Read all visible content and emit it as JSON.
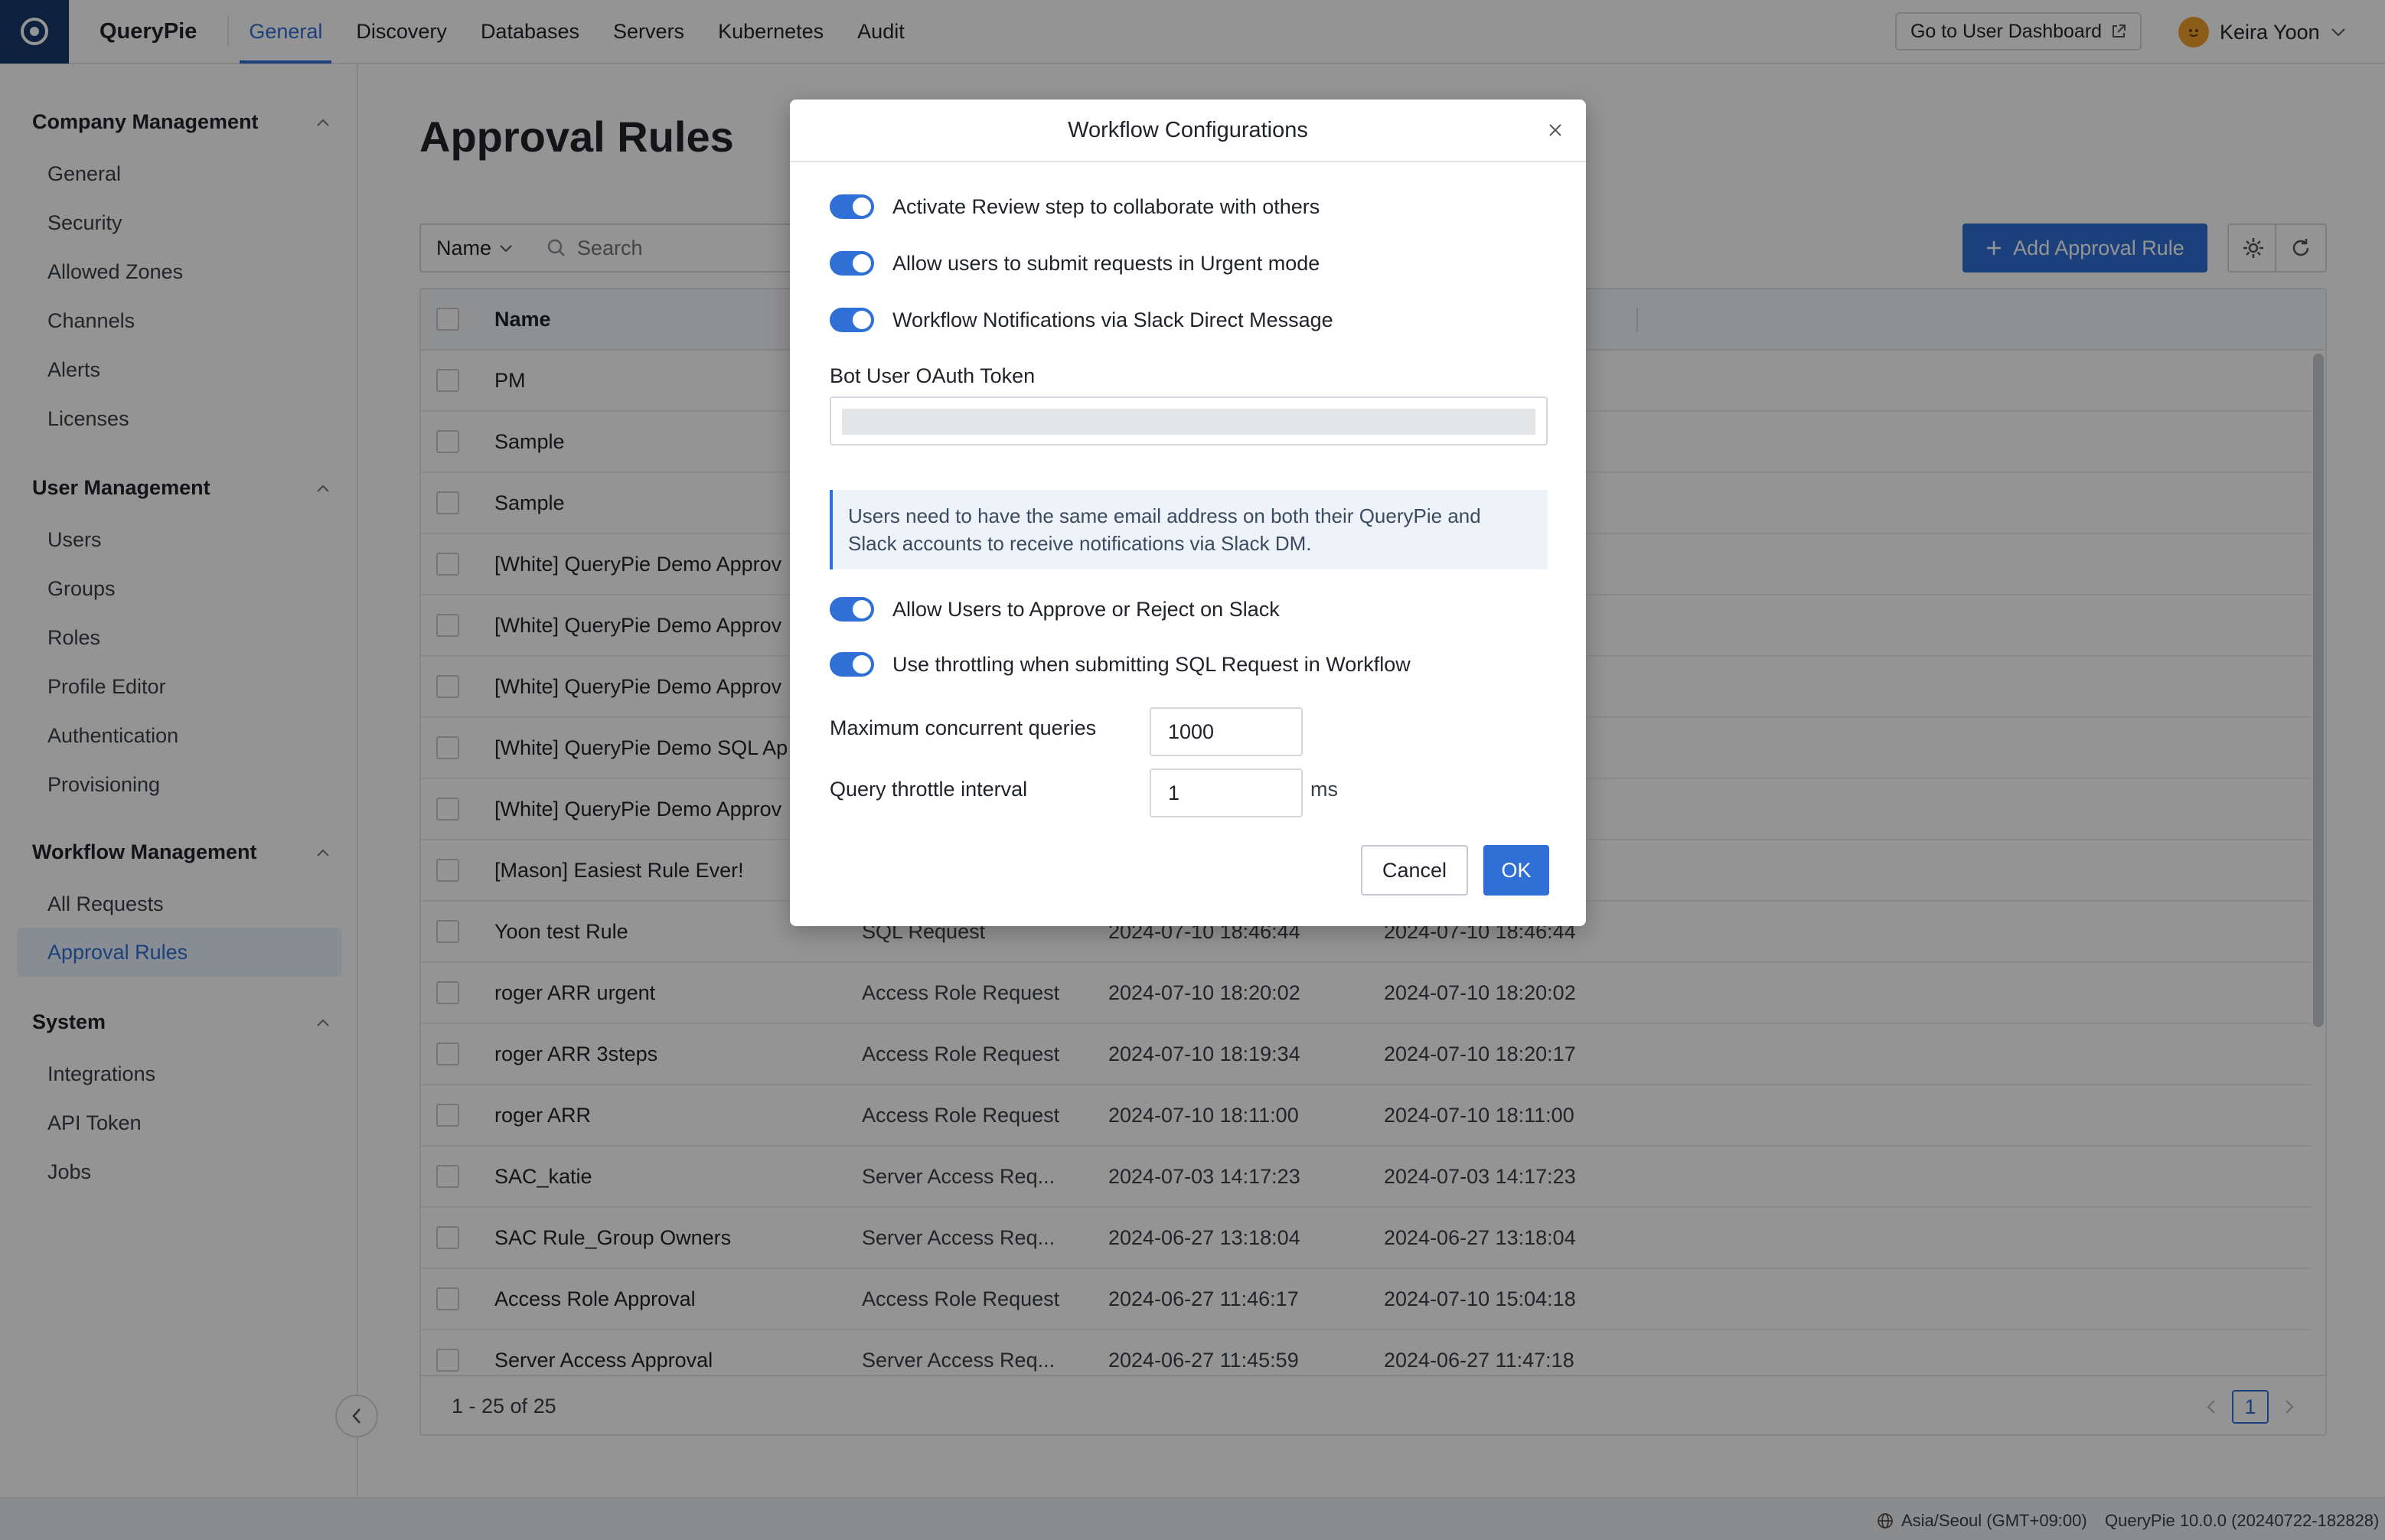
{
  "app": {
    "name": "QueryPie"
  },
  "nav": {
    "tabs": [
      "General",
      "Discovery",
      "Databases",
      "Servers",
      "Kubernetes",
      "Audit"
    ],
    "active_tab": "General",
    "dashboard_button": "Go to User Dashboard",
    "user_name": "Keira Yoon"
  },
  "sidebar": {
    "groups": [
      {
        "label": "Company Management",
        "items": [
          "General",
          "Security",
          "Allowed Zones",
          "Channels",
          "Alerts",
          "Licenses"
        ]
      },
      {
        "label": "User Management",
        "items": [
          "Users",
          "Groups",
          "Roles",
          "Profile Editor",
          "Authentication",
          "Provisioning"
        ]
      },
      {
        "label": "Workflow Management",
        "items": [
          "All Requests",
          "Approval Rules"
        ]
      },
      {
        "label": "System",
        "items": [
          "Integrations",
          "API Token",
          "Jobs"
        ]
      }
    ],
    "active_item": "Approval Rules"
  },
  "page": {
    "title": "Approval Rules",
    "filter_select": "Name",
    "search_placeholder": "Search",
    "add_button": "Add Approval Rule"
  },
  "table": {
    "header_name": "Name",
    "rows": [
      {
        "name": "PM",
        "type": "",
        "created": "",
        "updated": ""
      },
      {
        "name": "Sample",
        "type": "",
        "created": "",
        "updated": ""
      },
      {
        "name": "Sample",
        "type": "",
        "created": "",
        "updated": ""
      },
      {
        "name": "[White] QueryPie Demo Approv",
        "type": "",
        "created": "",
        "updated": ""
      },
      {
        "name": "[White] QueryPie Demo Approv",
        "type": "",
        "created": "",
        "updated": ""
      },
      {
        "name": "[White] QueryPie Demo Approv",
        "type": "",
        "created": "",
        "updated": ""
      },
      {
        "name": "[White] QueryPie Demo SQL Ap",
        "type": "",
        "created": "",
        "updated": ""
      },
      {
        "name": "[White] QueryPie Demo Approv",
        "type": "",
        "created": "",
        "updated": ""
      },
      {
        "name": "[Mason] Easiest Rule Ever!",
        "type": "",
        "created": "",
        "updated": ""
      },
      {
        "name": "Yoon test Rule",
        "type": "SQL Request",
        "created": "2024-07-10 18:46:44",
        "updated": "2024-07-10 18:46:44"
      },
      {
        "name": "roger ARR urgent",
        "type": "Access Role Request",
        "created": "2024-07-10 18:20:02",
        "updated": "2024-07-10 18:20:02"
      },
      {
        "name": "roger ARR 3steps",
        "type": "Access Role Request",
        "created": "2024-07-10 18:19:34",
        "updated": "2024-07-10 18:20:17"
      },
      {
        "name": "roger ARR",
        "type": "Access Role Request",
        "created": "2024-07-10 18:11:00",
        "updated": "2024-07-10 18:11:00"
      },
      {
        "name": "SAC_katie",
        "type": "Server Access Req...",
        "created": "2024-07-03 14:17:23",
        "updated": "2024-07-03 14:17:23"
      },
      {
        "name": "SAC Rule_Group Owners",
        "type": "Server Access Req...",
        "created": "2024-06-27 13:18:04",
        "updated": "2024-06-27 13:18:04"
      },
      {
        "name": "Access Role Approval",
        "type": "Access Role Request",
        "created": "2024-06-27 11:46:17",
        "updated": "2024-07-10 15:04:18"
      },
      {
        "name": "Server Access Approval",
        "type": "Server Access Req...",
        "created": "2024-06-27 11:45:59",
        "updated": "2024-06-27 11:47:18"
      }
    ],
    "footer_count": "1 - 25 of 25",
    "current_page": "1"
  },
  "status_bar": {
    "timezone": "Asia/Seoul (GMT+09:00)",
    "version": "QueryPie 10.0.0 (20240722-182828)"
  },
  "modal": {
    "title": "Workflow Configurations",
    "toggles": [
      {
        "label": "Activate Review step to collaborate with others",
        "on": true
      },
      {
        "label": "Allow users to submit requests in Urgent mode",
        "on": true
      },
      {
        "label": "Workflow Notifications via Slack Direct Message",
        "on": true
      }
    ],
    "token_label": "Bot User OAuth Token",
    "info_text": "Users need to have the same email address on both their QueryPie and Slack accounts to receive notifications via Slack DM.",
    "toggles2": [
      {
        "label": "Allow Users to Approve or Reject on Slack",
        "on": true
      },
      {
        "label": "Use throttling when submitting SQL Request in Workflow",
        "on": true
      }
    ],
    "max_queries_label": "Maximum concurrent queries",
    "max_queries_value": "1000",
    "throttle_label": "Query throttle interval",
    "throttle_value": "1",
    "throttle_unit": "ms",
    "cancel": "Cancel",
    "ok": "OK"
  },
  "colors": {
    "accent": "#2f6fd6",
    "logo_bg": "#173a6b"
  }
}
